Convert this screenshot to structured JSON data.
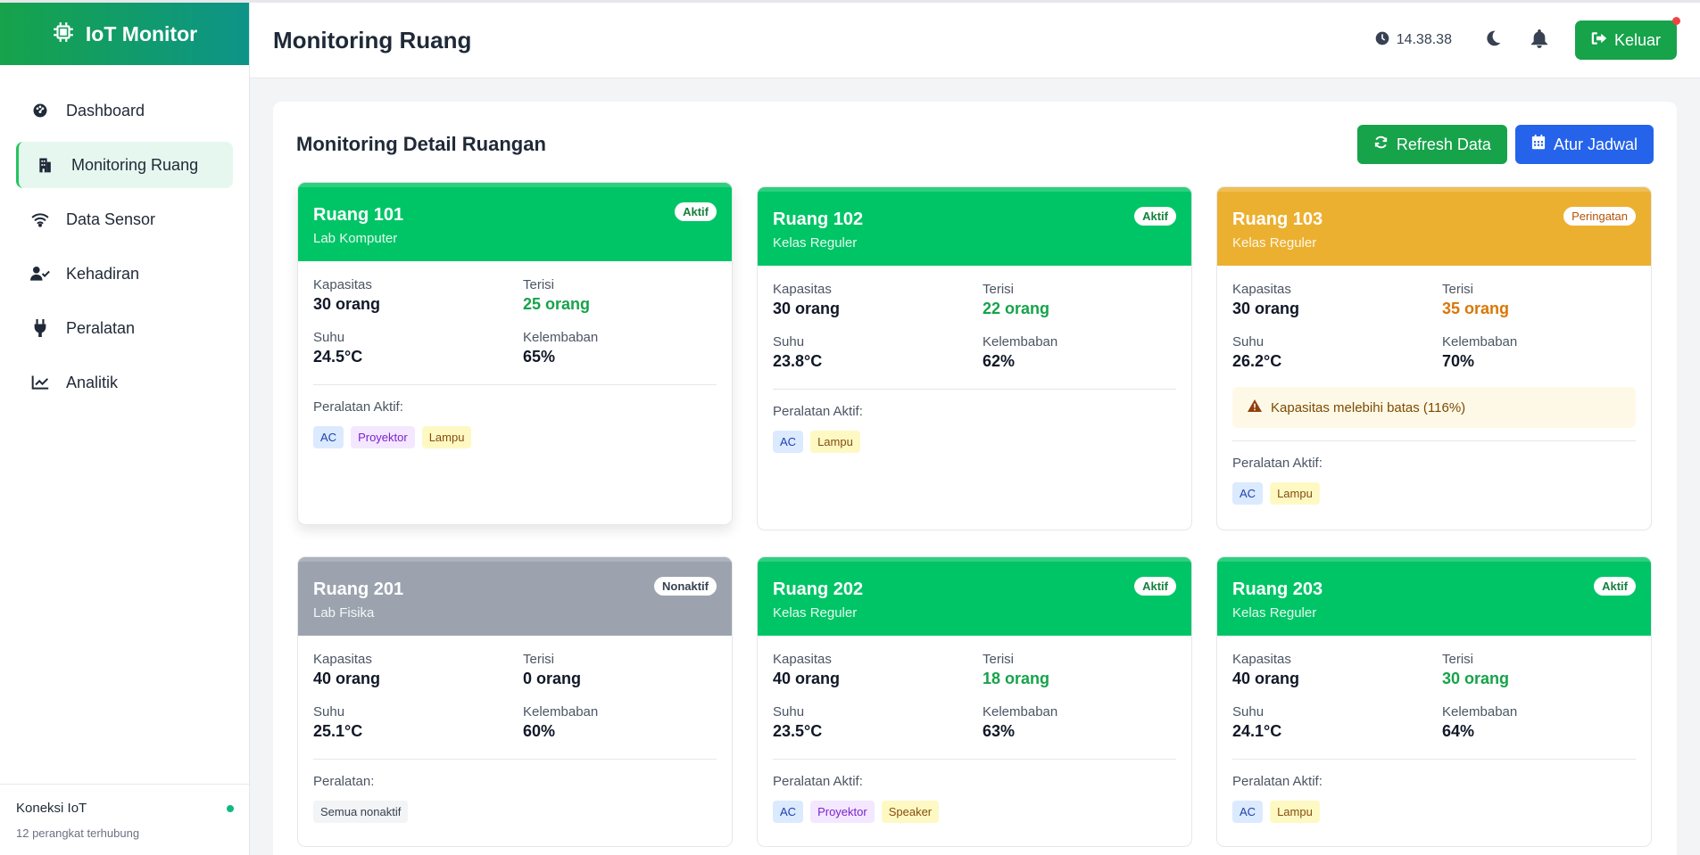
{
  "app": {
    "brand": "IoT Monitor",
    "page_title": "Monitoring Ruang"
  },
  "sidebar": {
    "items": [
      {
        "label": "Dashboard",
        "icon": "palette-icon"
      },
      {
        "label": "Monitoring Ruang",
        "icon": "building-icon",
        "active": true
      },
      {
        "label": "Data Sensor",
        "icon": "wifi-icon"
      },
      {
        "label": "Kehadiran",
        "icon": "user-check-icon"
      },
      {
        "label": "Peralatan",
        "icon": "plug-icon"
      },
      {
        "label": "Analitik",
        "icon": "chart-line-icon"
      }
    ],
    "connection": {
      "title": "Koneksi IoT",
      "subtitle": "12 perangkat terhubung",
      "status_color": "#10b981"
    }
  },
  "header": {
    "time": "14.38.38",
    "logout_label": "Keluar"
  },
  "panel": {
    "title": "Monitoring Detail Ruangan",
    "refresh_label": "Refresh Data",
    "schedule_label": "Atur Jadwal"
  },
  "labels": {
    "capacity": "Kapasitas",
    "filled": "Terisi",
    "temp": "Suhu",
    "humidity": "Kelembaban",
    "active_equipment": "Peralatan Aktif:",
    "equipment": "Peralatan:"
  },
  "rooms": [
    {
      "name": "Ruang 101",
      "type": "Lab Komputer",
      "status": "Aktif",
      "capacity": "30 orang",
      "filled": "25 orang",
      "temp": "24.5°C",
      "humidity": "65%",
      "equipment_label": "Peralatan Aktif:",
      "equipment": [
        "AC",
        "Proyektor",
        "Lampu"
      ]
    },
    {
      "name": "Ruang 102",
      "type": "Kelas Reguler",
      "status": "Aktif",
      "capacity": "30 orang",
      "filled": "22 orang",
      "temp": "23.8°C",
      "humidity": "62%",
      "equipment_label": "Peralatan Aktif:",
      "equipment": [
        "AC",
        "Lampu"
      ]
    },
    {
      "name": "Ruang 103",
      "type": "Kelas Reguler",
      "status": "Peringatan",
      "capacity": "30 orang",
      "filled": "35 orang",
      "temp": "26.2°C",
      "humidity": "70%",
      "warning": "Kapasitas melebihi batas (116%)",
      "equipment_label": "Peralatan Aktif:",
      "equipment": [
        "AC",
        "Lampu"
      ]
    },
    {
      "name": "Ruang 201",
      "type": "Lab Fisika",
      "status": "Nonaktif",
      "capacity": "40 orang",
      "filled": "0 orang",
      "temp": "25.1°C",
      "humidity": "60%",
      "equipment_label": "Peralatan:",
      "equipment": [
        "Semua nonaktif"
      ]
    },
    {
      "name": "Ruang 202",
      "type": "Kelas Reguler",
      "status": "Aktif",
      "capacity": "40 orang",
      "filled": "18 orang",
      "temp": "23.5°C",
      "humidity": "63%",
      "equipment_label": "Peralatan Aktif:",
      "equipment": [
        "AC",
        "Proyektor",
        "Speaker"
      ]
    },
    {
      "name": "Ruang 203",
      "type": "Kelas Reguler",
      "status": "Aktif",
      "capacity": "40 orang",
      "filled": "30 orang",
      "temp": "24.1°C",
      "humidity": "64%",
      "equipment_label": "Peralatan Aktif:",
      "equipment": [
        "AC",
        "Lampu"
      ]
    }
  ],
  "colors": {
    "brand_green": "#16a34a",
    "active_header": "#00c566",
    "warning_header": "#ecb030",
    "inactive_header": "#9ca3af",
    "blue_button": "#2563eb"
  }
}
